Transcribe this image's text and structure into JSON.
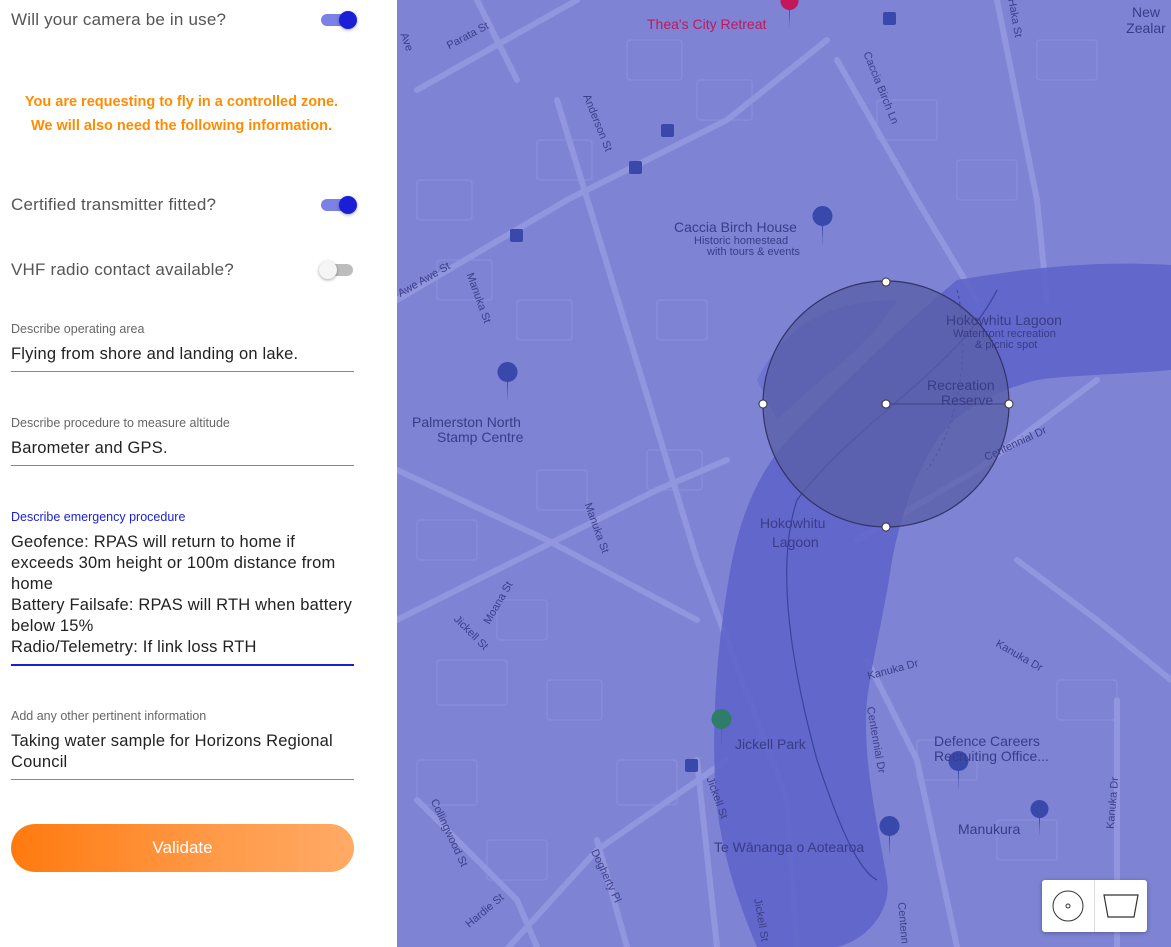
{
  "form": {
    "camera_label": "Will your camera be in use?",
    "camera_on": true,
    "notice_line1": "You are requesting to fly in a controlled zone.",
    "notice_line2": "We will also need the following information.",
    "transmitter_label": "Certified transmitter fitted?",
    "transmitter_on": true,
    "vhf_label": "VHF radio contact available?",
    "vhf_on": false,
    "operating_area": {
      "label": "Describe operating area",
      "value": "Flying from shore and landing on lake."
    },
    "altitude": {
      "label": "Describe procedure to measure altitude",
      "value": "Barometer and GPS."
    },
    "emergency": {
      "label": "Describe emergency procedure",
      "value": "Geofence: RPAS will return to home if exceeds 30m height or 100m distance from home\nBattery Failsafe: RPAS will RTH when battery below 15%\nRadio/Telemetry: If link loss RTH"
    },
    "other_info": {
      "label": "Add any other pertinent information",
      "value": "Taking water sample for Horizons Regional Council"
    },
    "validate_label": "Validate"
  },
  "map": {
    "places": {
      "theas": "Thea's City Retreat",
      "new_zealand": "New Zealar",
      "caccia_house": "Caccia Birch House",
      "caccia_desc1": "Historic homestead",
      "caccia_desc2": "with tours & events",
      "lagoon_top": "Hokowhitu Lagoon",
      "lagoon_top_desc1": "Waterfront recreation",
      "lagoon_top_desc2": "& picnic spot",
      "rec_reserve1": "Recreation",
      "rec_reserve2": "Reserve",
      "lagoon_bottom1": "Hokowhitu",
      "lagoon_bottom2": "Lagoon",
      "stamp_centre1": "Palmerston North",
      "stamp_centre2": "Stamp Centre",
      "jickell_park": "Jickell Park",
      "defence1": "Defence Careers",
      "defence2": "Recruiting Office...",
      "manukura": "Manukura",
      "te_wananga": "Te Wānanga o Aotearoa"
    },
    "roads": {
      "parata": "Parata St",
      "anderson": "Anderson St",
      "caccia_ln": "Caccia Birch Ln",
      "awe_awe": "Awe Awe St",
      "manuka1": "Manuka St",
      "manuka2": "Manuka St",
      "moana": "Moana St",
      "jickell1": "Jickell St",
      "jickell2": "Jickell St",
      "jickell3": "Jickell St",
      "centennial1": "Centennial Dr",
      "centennial2": "Centennial Dr",
      "kanuka1": "Kanuka Dr",
      "kanuka2": "Kanuka Dr",
      "kanuka3": "Kanuka Dr",
      "collingwood": "Collingwood St",
      "dogherty": "Dogherty Pl",
      "hardie": "Hardie St",
      "haka": "Haka St",
      "ave": "Ave",
      "centenn": "Centenn"
    },
    "tools": {
      "circle_tool": "circle-draw-icon",
      "polygon_tool": "polygon-draw-icon"
    },
    "colors": {
      "overlay": "#7e83d4",
      "water": "#5c63c9",
      "zone": "#5a5da6"
    }
  }
}
